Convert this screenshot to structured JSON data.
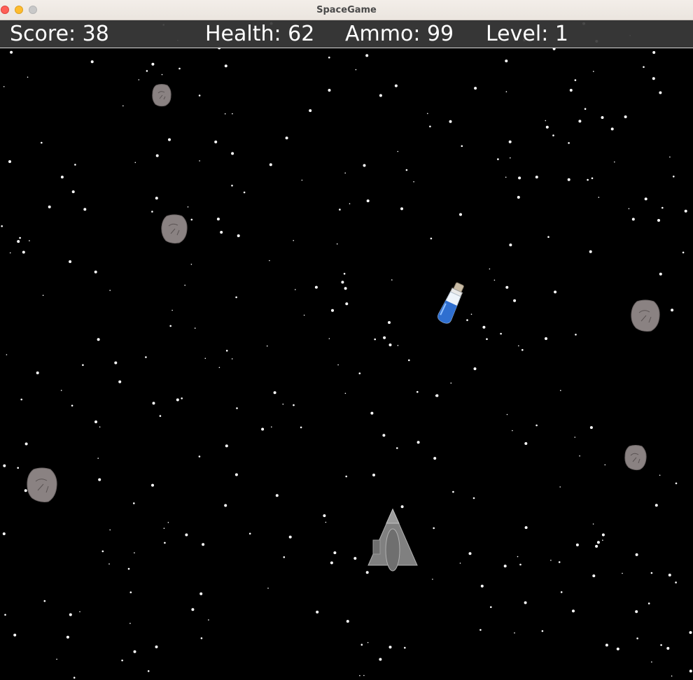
{
  "window": {
    "title": "SpaceGame"
  },
  "hud": {
    "score_label": "Score: 38",
    "health_label": "Health: 62",
    "ammo_label": "Ammo: 99",
    "level_label": "Level: 1",
    "score": 38,
    "health": 62,
    "ammo": 99,
    "level": 1
  },
  "sprites": {
    "player": "spaceship-icon",
    "asteroid": "asteroid-icon",
    "pickup": "potion-bottle-icon"
  },
  "colors": {
    "space": "#000000",
    "hud_bar": "#3a3a3a",
    "hud_text": "#ffffff",
    "asteroid": "#8a8282",
    "ship": "#808080",
    "potion_liquid": "#2f6fd0"
  }
}
